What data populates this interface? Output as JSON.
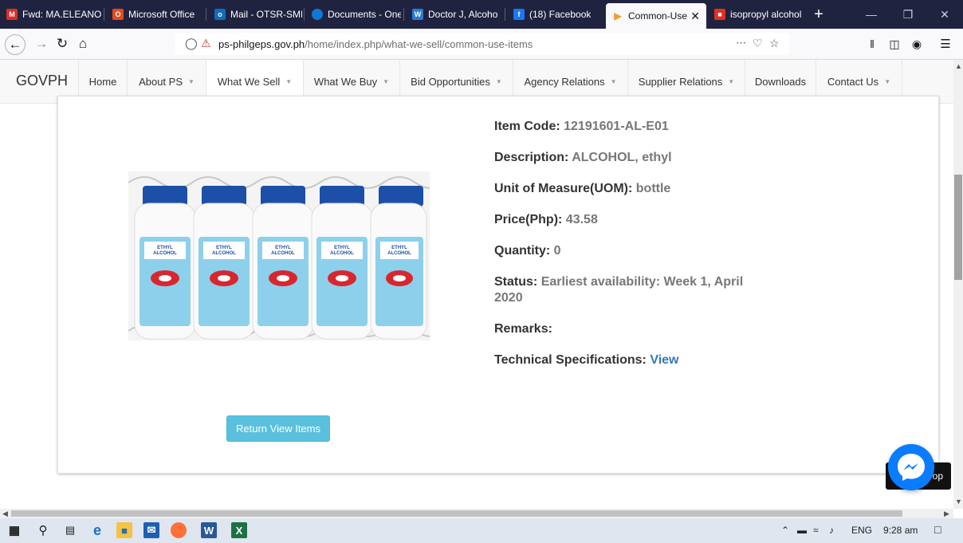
{
  "browser": {
    "tabs": [
      {
        "label": "Fwd: MA.ELEANO",
        "icon": "gmail-icon",
        "color": "#d93025"
      },
      {
        "label": "Microsoft Office",
        "icon": "office-icon",
        "color": "#e64a19"
      },
      {
        "label": "Mail - OTSR-SME",
        "icon": "outlook-icon",
        "color": "#0f6cbd"
      },
      {
        "label": "Documents - One",
        "icon": "onedrive-icon",
        "color": "#0f78d4"
      },
      {
        "label": "Doctor J,  Alcoho",
        "icon": "word-icon",
        "color": "#2b7cd3"
      },
      {
        "label": "(18) Facebook",
        "icon": "facebook-icon",
        "color": "#1877f2"
      },
      {
        "label": "Common-Use",
        "icon": "philgeps-icon",
        "color": "#f0a030",
        "active": true
      },
      {
        "label": "isopropyl alcohol",
        "icon": "shopping-bag-icon",
        "color": "#e0311e"
      }
    ],
    "url_domain": "ps-philgeps.gov.ph",
    "url_path": "/home/index.php/what-we-sell/common-use-items"
  },
  "site": {
    "brand": "GOVPH",
    "nav": [
      {
        "label": "Home",
        "caret": false
      },
      {
        "label": "About PS",
        "caret": true
      },
      {
        "label": "What We Sell",
        "caret": true,
        "active": true
      },
      {
        "label": "What We Buy",
        "caret": true
      },
      {
        "label": "Bid Opportunities",
        "caret": true
      },
      {
        "label": "Agency Relations",
        "caret": true
      },
      {
        "label": "Supplier Relations",
        "caret": true
      },
      {
        "label": "Downloads",
        "caret": false
      },
      {
        "label": "Contact Us",
        "caret": true
      }
    ]
  },
  "product": {
    "item_code_label": "Item Code:",
    "item_code": "12191601-AL-E01",
    "description_label": "Description:",
    "description": "ALCOHOL, ethyl",
    "uom_label": "Unit of Measure(UOM):",
    "uom": "bottle",
    "price_label": "Price(Php):",
    "price": "43.58",
    "quantity_label": "Quantity:",
    "quantity": "0",
    "status_label": "Status:",
    "status": "Earliest availability: Week 1, April 2020",
    "remarks_label": "Remarks:",
    "remarks": "",
    "tech_spec_label": "Technical Specifications:",
    "tech_spec_link": "View",
    "bottle_label_line1": "ETHYL",
    "bottle_label_line2": "ALCOHOL"
  },
  "buttons": {
    "return": "Return View Items",
    "back_to_top": "op"
  },
  "taskbar": {
    "tray_lang": "ENG",
    "time": "9:28 am"
  },
  "colors": {
    "browser_chrome": "#202340",
    "button_info": "#5bc0de",
    "link": "#337ab7",
    "messenger": "#0a7cff"
  }
}
